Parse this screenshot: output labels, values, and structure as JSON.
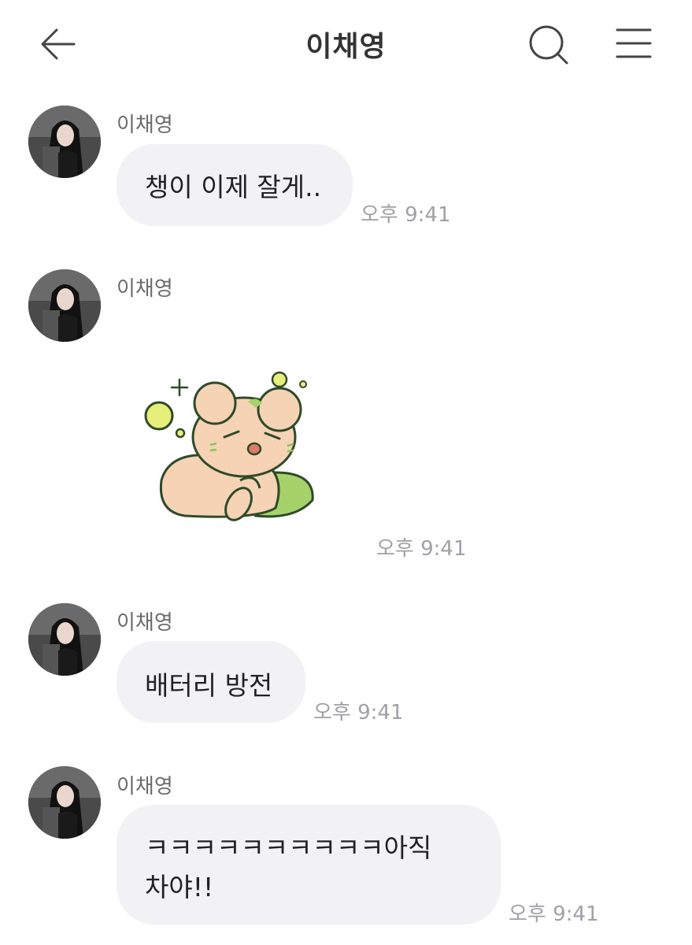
{
  "header": {
    "title": "이채영"
  },
  "messages": [
    {
      "sender": "이채영",
      "text": "챙이 이제 잘게..",
      "time": "오후 9:41"
    },
    {
      "sender": "이채영",
      "sticker": "hamster-sleepy-sticker",
      "time": "오후 9:41"
    },
    {
      "sender": "이채영",
      "text": "배터리 방전",
      "time": "오후 9:41"
    },
    {
      "sender": "이채영",
      "text_line1": "ㅋㅋㅋㅋㅋㅋㅋㅋㅋㅋ아직",
      "text_line2": "차야!!",
      "time": "오후 9:41"
    }
  ],
  "colors": {
    "bubble": "#f2f2f5",
    "time": "#a0a0a6",
    "sender": "#6b6b6b",
    "sticker_body": "#f6d3b4",
    "sticker_accent": "#a5d36a",
    "sticker_bubbles": "#e6ef7a"
  }
}
